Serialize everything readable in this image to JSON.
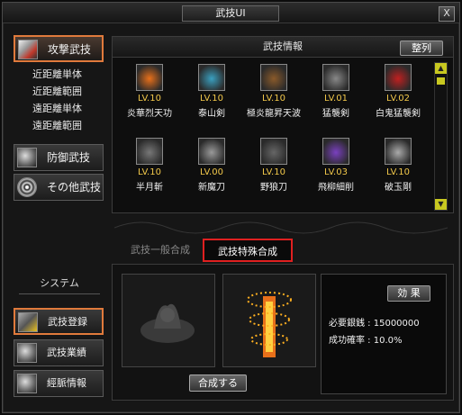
{
  "window": {
    "title": "武技UI",
    "close_label": "X"
  },
  "categories": [
    {
      "label": "攻撃武技",
      "icon": "sword-icon",
      "active": true
    },
    {
      "label": "防御武技",
      "icon": "figure-icon",
      "active": false
    },
    {
      "label": "その他武技",
      "icon": "swirl-icon",
      "active": false
    }
  ],
  "subitems": [
    "近距離単体",
    "近距離範囲",
    "遠距離単体",
    "遠距離範囲"
  ],
  "info": {
    "header": "武技情報",
    "sort_label": "整列",
    "skills": [
      {
        "lv": "LV.10",
        "name": "炎華烈天功",
        "icon": "fire-pillar-icon",
        "color": "#e8701a"
      },
      {
        "lv": "LV.10",
        "name": "泰山剣",
        "icon": "blue-splash-icon",
        "color": "#3aa0c0"
      },
      {
        "lv": "LV.10",
        "name": "極炎龍昇天波",
        "icon": "dragon-icon",
        "color": "#8a5a2a"
      },
      {
        "lv": "LV.01",
        "name": "猛襲剣",
        "icon": "claw-icon",
        "color": "#888888"
      },
      {
        "lv": "LV.02",
        "name": "白鬼猛襲剣",
        "icon": "white-flame-icon",
        "color": "#c02020"
      },
      {
        "lv": "LV.10",
        "name": "半月斬",
        "icon": "crescent-icon",
        "color": "#777777"
      },
      {
        "lv": "LV.00",
        "name": "新魔刀",
        "icon": "spiral-icon",
        "color": "#999999"
      },
      {
        "lv": "LV.10",
        "name": "野狼刀",
        "icon": "wolf-icon",
        "color": "#666666"
      },
      {
        "lv": "LV.03",
        "name": "飛柳細削",
        "icon": "purple-orb-icon",
        "color": "#7a40c0"
      },
      {
        "lv": "LV.10",
        "name": "破玉剛",
        "icon": "fist-icon",
        "color": "#aaaaaa"
      }
    ]
  },
  "tabs": [
    {
      "label": "武技一般合成",
      "active": false
    },
    {
      "label": "武技特殊合成",
      "active": true
    }
  ],
  "compose": {
    "effect_label": "効 果",
    "cost_label": "必要銀銭 : 15000000",
    "rate_label": "成功確率 : 10.0%",
    "combine_label": "合成する"
  },
  "system": {
    "label": "システム",
    "buttons": [
      {
        "label": "武技登録",
        "icon": "register-icon",
        "active": true
      },
      {
        "label": "武技業績",
        "icon": "quill-icon",
        "active": false
      },
      {
        "label": "經脈情報",
        "icon": "body-icon",
        "active": false
      }
    ]
  },
  "colors": {
    "accent": "#e07a3c",
    "highlight": "#e02020",
    "level": "#f2c84a"
  }
}
